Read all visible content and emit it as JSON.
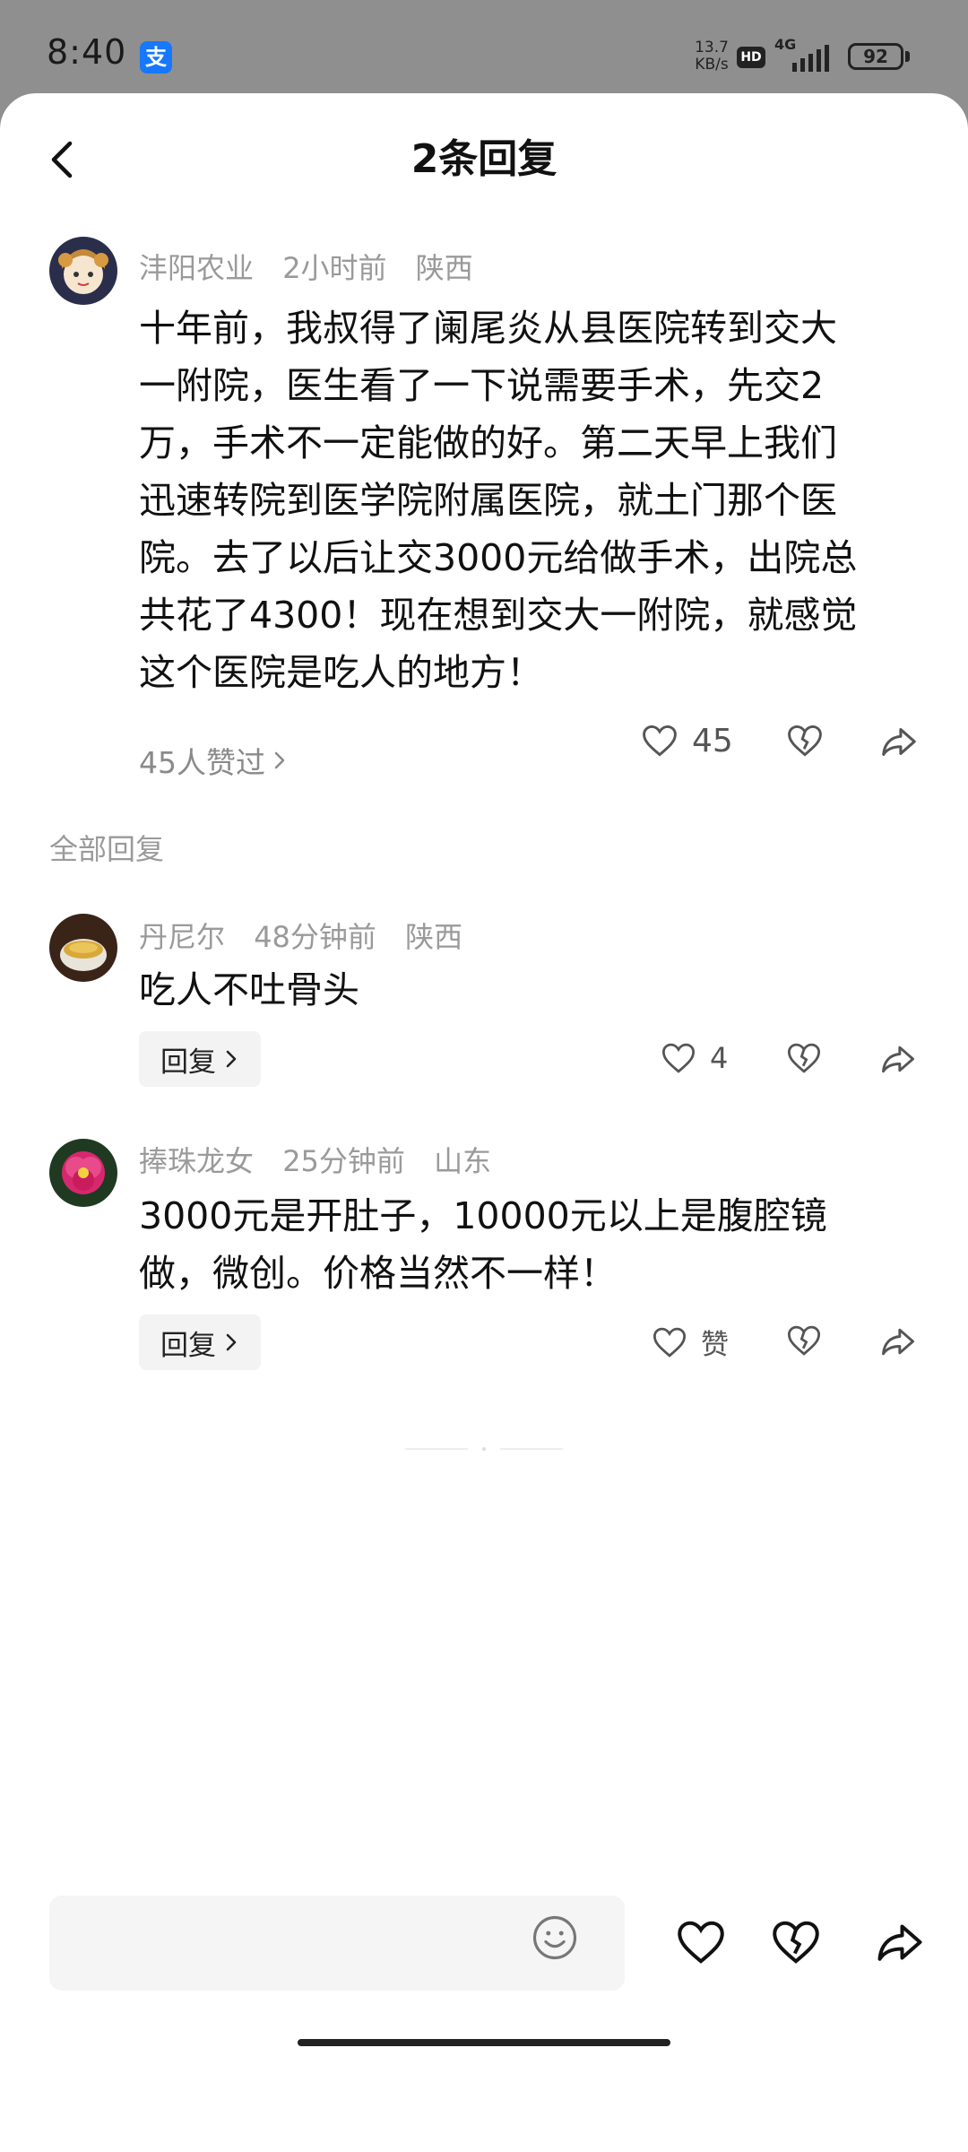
{
  "status_bar": {
    "time": "8:40",
    "alipay_icon_char": "支",
    "net_speed_value": "13.7",
    "net_speed_unit": "KB/s",
    "hd": "HD",
    "network": "4G",
    "battery": "92"
  },
  "header": {
    "title": "2条回复"
  },
  "main_comment": {
    "author": "沣阳农业",
    "time": "2小时前",
    "location": "陕西",
    "lines": [
      "十年前，我叔得了阑尾炎从县医院转到交大",
      "一附院，医生看了一下说需要手术，先交2",
      "万，手术不一定能做的好。第二天早上我们",
      "迅速转院到医学院附属医院，就土门那个医",
      "院。去了以后让交3000元给做手术，出院总",
      "共花了4300！现在想到交大一附院，就感觉",
      "这个医院是吃人的地方！"
    ],
    "liked_by": "45人赞过",
    "like_count": "45"
  },
  "section_label": "全部回复",
  "replies": [
    {
      "author": "丹尼尔",
      "time": "48分钟前",
      "location": "陕西",
      "text": "吃人不吐骨头",
      "reply_label": "回复",
      "like_count": "4"
    },
    {
      "author": "捧珠龙女",
      "time": "25分钟前",
      "location": "山东",
      "lines": [
        "3000元是开肚子，10000元以上是腹腔镜",
        "做，微创。价格当然不一样！"
      ],
      "reply_label": "回复",
      "like_label": "赞"
    }
  ],
  "colors": {
    "status_bg": "#8f8f8f",
    "meta_text": "#9a9a9a",
    "alipay_blue": "#1677ff"
  },
  "icons": [
    "back-icon",
    "heart-icon",
    "broken-heart-icon",
    "share-icon",
    "emoji-icon",
    "chevron-right-icon"
  ]
}
